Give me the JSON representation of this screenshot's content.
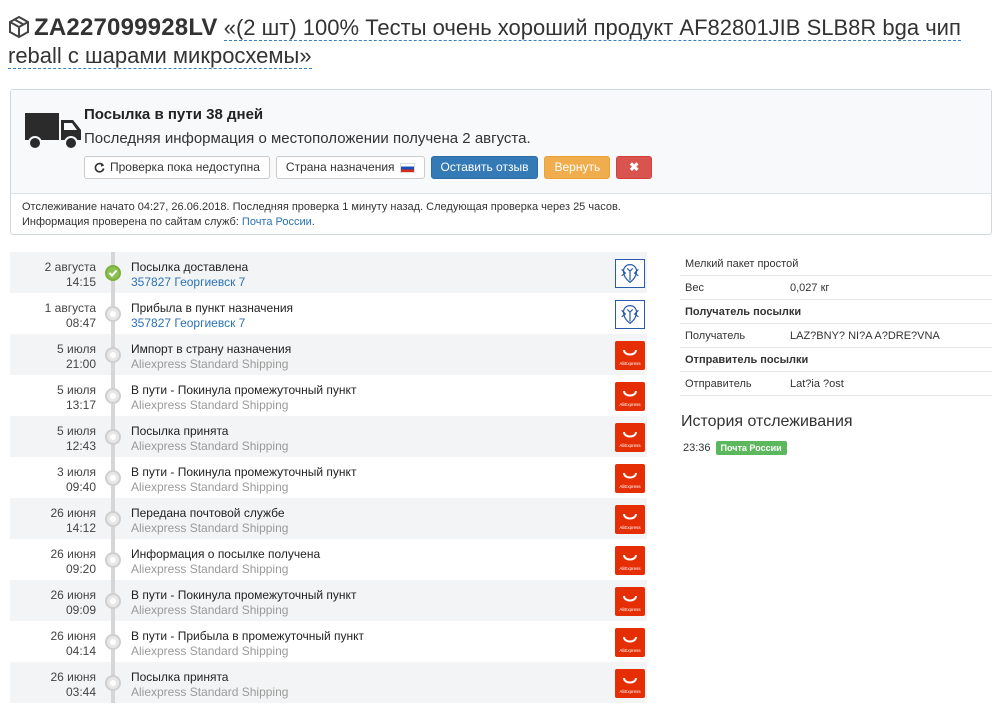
{
  "header": {
    "tracking_number": "ZA227099928LV",
    "title": "«(2 шт) 100% Тесты очень хороший продукт AF82801JIB SLB8R bga чип reball с шарами микросхемы»"
  },
  "status": {
    "title": "Посылка в пути 38 дней",
    "subtitle": "Последняя информация о местоположении получена 2 августа.",
    "buttons": {
      "check": "Проверка пока недоступна",
      "country": "Страна назначения",
      "review": "Оставить отзыв",
      "return": "Вернуть",
      "close": "✖"
    },
    "footer_line1": "Отслеживание начато 04:27, 26.06.2018. Последняя проверка 1 минуту назад. Следующая проверка через 25 часов.",
    "footer_line2_prefix": "Информация проверена по сайтам служб: ",
    "footer_link": "Почта России",
    "footer_line2_suffix": "."
  },
  "events": [
    {
      "date": "2 августа",
      "time": "14:15",
      "title": "Посылка доставлена",
      "detail": "357827 Георгиевск 7",
      "detail_type": "loc",
      "source": "post",
      "delivered": true
    },
    {
      "date": "1 августа",
      "time": "08:47",
      "title": "Прибыла в пункт назначения",
      "detail": "357827 Георгиевск 7",
      "detail_type": "loc",
      "source": "post",
      "delivered": false
    },
    {
      "date": "5 июля",
      "time": "21:00",
      "title": "Импорт в страну назначения",
      "detail": "Aliexpress Standard Shipping",
      "detail_type": "srv",
      "source": "ali",
      "delivered": false
    },
    {
      "date": "5 июля",
      "time": "13:17",
      "title": "В пути - Покинула промежуточный пункт",
      "detail": "Aliexpress Standard Shipping",
      "detail_type": "srv",
      "source": "ali",
      "delivered": false
    },
    {
      "date": "5 июля",
      "time": "12:43",
      "title": "Посылка принята",
      "detail": "Aliexpress Standard Shipping",
      "detail_type": "srv",
      "source": "ali",
      "delivered": false
    },
    {
      "date": "3 июля",
      "time": "09:40",
      "title": "В пути - Покинула промежуточный пункт",
      "detail": "Aliexpress Standard Shipping",
      "detail_type": "srv",
      "source": "ali",
      "delivered": false
    },
    {
      "date": "26 июня",
      "time": "14:12",
      "title": "Передана почтовой службе",
      "detail": "Aliexpress Standard Shipping",
      "detail_type": "srv",
      "source": "ali",
      "delivered": false
    },
    {
      "date": "26 июня",
      "time": "09:20",
      "title": "Информация о посылке получена",
      "detail": "Aliexpress Standard Shipping",
      "detail_type": "srv",
      "source": "ali",
      "delivered": false
    },
    {
      "date": "26 июня",
      "time": "09:09",
      "title": "В пути - Покинула промежуточный пункт",
      "detail": "Aliexpress Standard Shipping",
      "detail_type": "srv",
      "source": "ali",
      "delivered": false
    },
    {
      "date": "26 июня",
      "time": "04:14",
      "title": "В пути - Прибыла в промежуточный пункт",
      "detail": "Aliexpress Standard Shipping",
      "detail_type": "srv",
      "source": "ali",
      "delivered": false
    },
    {
      "date": "26 июня",
      "time": "03:44",
      "title": "Посылка принята",
      "detail": "Aliexpress Standard Shipping",
      "detail_type": "srv",
      "source": "ali",
      "delivered": false
    }
  ],
  "info": {
    "package_type": "Мелкий пакет простой",
    "weight_label": "Вес",
    "weight_value": "0,027 кг",
    "recipient_header": "Получатель посылки",
    "recipient_label": "Получатель",
    "recipient_value": "LAZ?BNY? NI?A A?DRE?VNA",
    "sender_header": "Отправитель посылки",
    "sender_label": "Отправитель",
    "sender_value": "Lat?ia ?ost"
  },
  "history": {
    "title": "История отслеживания",
    "time": "23:36",
    "service": "Почта России"
  },
  "ali_logo_text": "AliExpress",
  "colors": {
    "link": "#2a72b5",
    "primary": "#337ab7",
    "warning": "#f0ad4e",
    "danger": "#d9534f",
    "success": "#5cb85c",
    "aliexpress": "#e62e04"
  }
}
